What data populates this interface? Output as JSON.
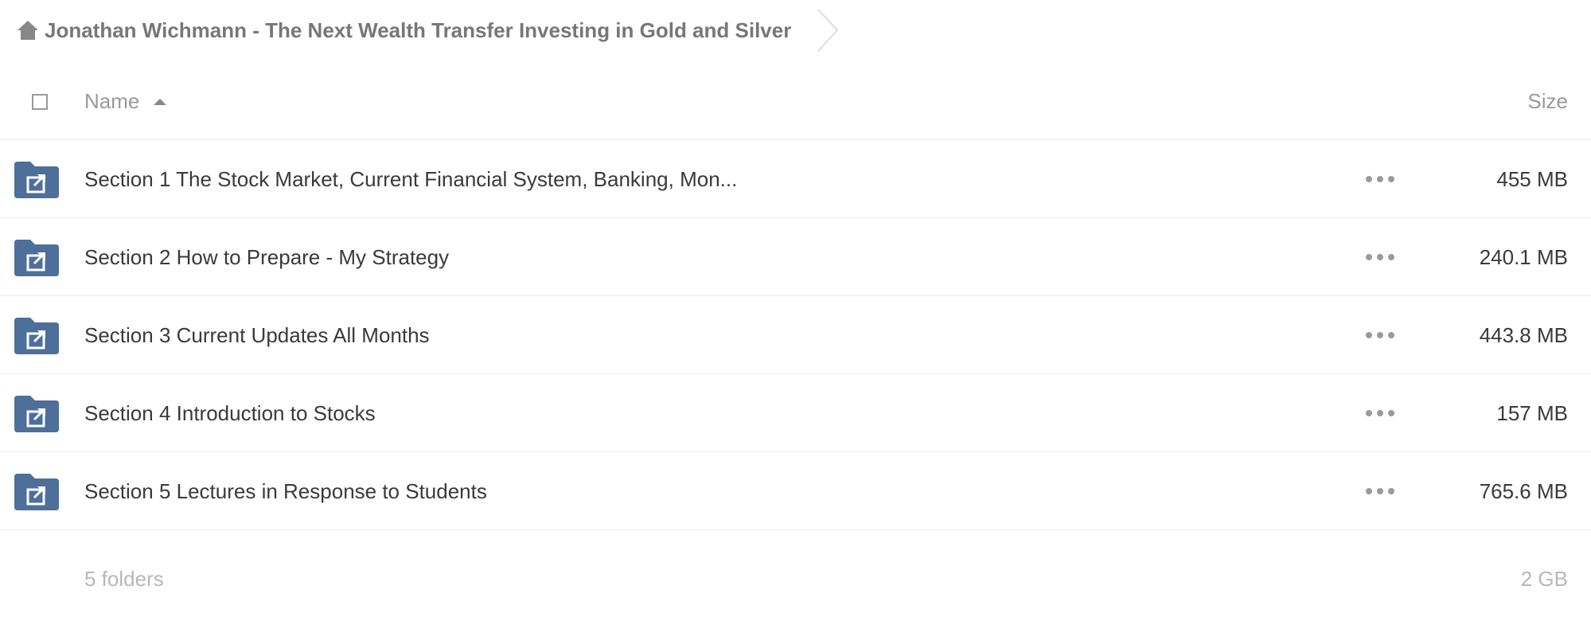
{
  "breadcrumb": {
    "home_icon": "home-icon",
    "title": "Jonathan Wichmann - The Next Wealth Transfer Investing in Gold and Silver"
  },
  "header": {
    "name_label": "Name",
    "size_label": "Size",
    "sort": "ascending"
  },
  "rows": [
    {
      "name": "Section 1 The Stock Market, Current Financial System, Banking, Mon...",
      "size": "455 MB",
      "icon": "shared-folder-icon"
    },
    {
      "name": "Section 2 How to Prepare - My Strategy",
      "size": "240.1 MB",
      "icon": "shared-folder-icon"
    },
    {
      "name": "Section 3 Current Updates All Months",
      "size": "443.8 MB",
      "icon": "shared-folder-icon"
    },
    {
      "name": "Section 4 Introduction to Stocks",
      "size": "157 MB",
      "icon": "shared-folder-icon"
    },
    {
      "name": "Section 5 Lectures in Response to Students",
      "size": "765.6 MB",
      "icon": "shared-folder-icon"
    }
  ],
  "footer": {
    "count": "5 folders",
    "total_size": "2 GB"
  },
  "colors": {
    "folder": "#4d6f9a",
    "text": "#3a3a3a",
    "muted": "#9a9a9a",
    "divider": "#ebebeb"
  }
}
